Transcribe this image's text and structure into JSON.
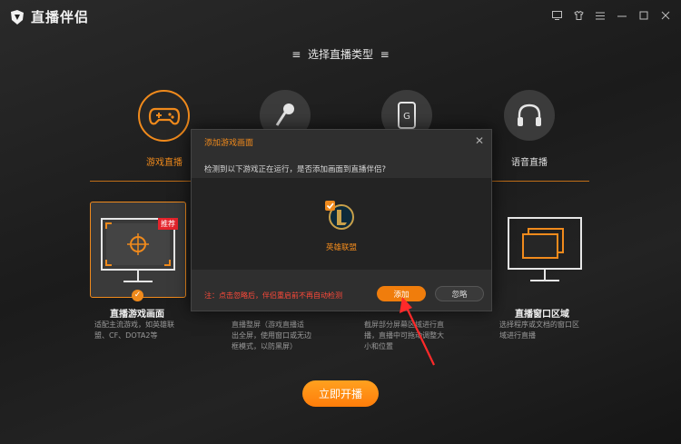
{
  "app": {
    "title": "直播伴侣"
  },
  "titlebar_icons": [
    "tv-icon",
    "shirt-icon",
    "menu-icon",
    "minimize-icon",
    "maximize-icon",
    "close-icon"
  ],
  "heading": "选择直播类型",
  "types": [
    {
      "label": "游戏直播",
      "icon": "gamepad-icon"
    },
    {
      "label": "",
      "icon": "microphone-icon"
    },
    {
      "label": "",
      "icon": "phone-icon"
    },
    {
      "label": "语音直播",
      "icon": "headphones-icon"
    }
  ],
  "cards": [
    {
      "title": "直播游戏画面",
      "desc": [
        "适配主流游戏，如英雄联",
        "盟、CF、DOTA2等"
      ],
      "badge": "推荐"
    },
    {
      "title": "",
      "desc": [
        "直播整屏（游戏直播适",
        "出全屏，使用窗口或无边",
        "框模式，以防黑屏）"
      ]
    },
    {
      "title": "",
      "desc": [
        "截屏部分屏幕区域进行直",
        "播，直播中可拖动调整大",
        "小和位置"
      ]
    },
    {
      "title": "直播窗口区域",
      "desc": [
        "选择程序或文档的窗口区",
        "域进行直播"
      ]
    }
  ],
  "start_button": "立即开播",
  "dialog": {
    "title": "添加游戏画面",
    "message": "检测到以下游戏正在运行，是否添加画面到直播伴侣?",
    "game_name": "英雄联盟",
    "note": "注：点击忽略后，伴侣重启前不再自动检测",
    "add_label": "添加",
    "ignore_label": "忽略"
  },
  "colors": {
    "accent": "#f08a1c",
    "danger": "#e5242c",
    "background": "#1f1f1f"
  }
}
